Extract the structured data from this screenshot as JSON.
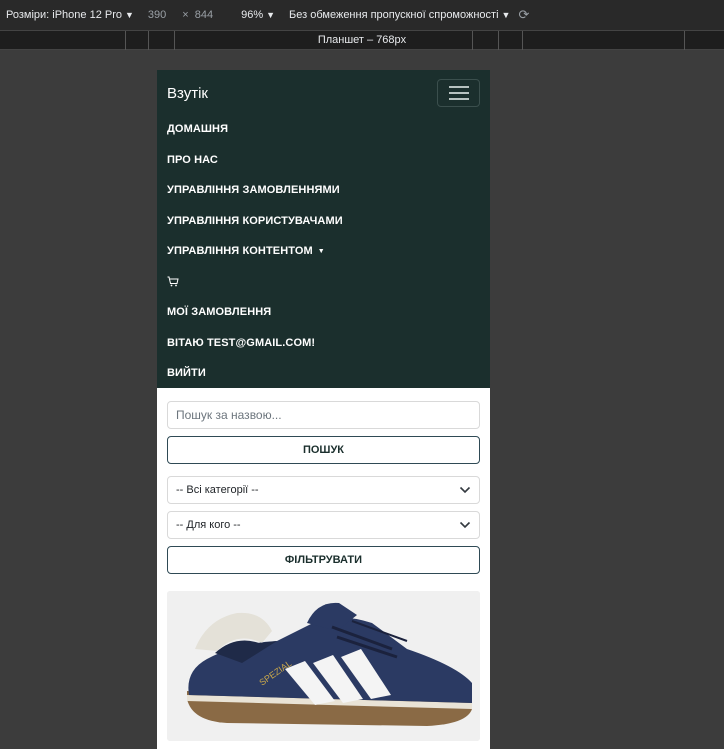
{
  "devtools": {
    "dimensions_label": "Розміри: iPhone 12 Pro",
    "width": "390",
    "times": "×",
    "height": "844",
    "zoom": "96%",
    "throttling": "Без обмеження пропускної спроможності",
    "media_query_label": "Планшет – 768px"
  },
  "navbar": {
    "brand": "Взутік",
    "items": [
      "ДОМАШНЯ",
      "ПРО НАС",
      "УПРАВЛІННЯ ЗАМОВЛЕННЯМИ",
      "УПРАВЛІННЯ КОРИСТУВАЧАМИ",
      "УПРАВЛІННЯ КОНТЕНТОМ",
      "МОЇ ЗАМОВЛЕННЯ",
      "ВІТАЮ TEST@GMAIL.COM!",
      "ВИЙТИ"
    ]
  },
  "search": {
    "placeholder": "Пошук за назвою...",
    "button": "ПОШУК"
  },
  "filters": {
    "category": "-- Всі категорії --",
    "for_whom": "-- Для кого --",
    "button": "ФІЛЬТРУВАТИ"
  },
  "colors": {
    "navbar_bg": "#1b2f2d",
    "button_border": "#2f4a55"
  }
}
